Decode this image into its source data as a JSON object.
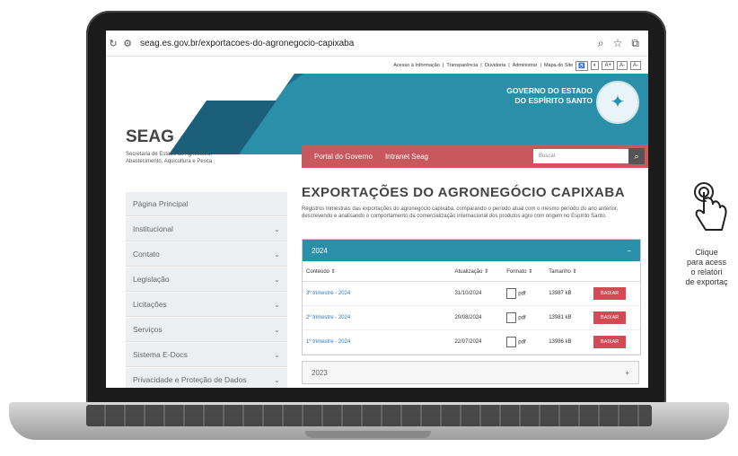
{
  "browser": {
    "url": "seag.es.gov.br/exportacoes-do-agronegocio-capixaba"
  },
  "access_bar": {
    "items": [
      "Acesso à Informação",
      "Transparência",
      "Ouvidoria",
      "Administrar",
      "Mapa do Site"
    ],
    "font_buttons": [
      "A+",
      "A-",
      "A-"
    ]
  },
  "header": {
    "org_short": "SEAG",
    "org_full": "Secretaria de Estado da Agricultura, Abastecimento, Aquicultura e Pesca",
    "gov_line1": "GOVERNO DO ESTADO",
    "gov_line2": "DO ESPÍRITO SANTO"
  },
  "nav": {
    "links": [
      "Portal do Governo",
      "Intranet Seag"
    ],
    "search_placeholder": "Buscar"
  },
  "sidebar": {
    "items": [
      {
        "label": "Página Principal",
        "chevron": false
      },
      {
        "label": "Institucional",
        "chevron": true
      },
      {
        "label": "Contato",
        "chevron": true
      },
      {
        "label": "Legislação",
        "chevron": true
      },
      {
        "label": "Licitações",
        "chevron": true
      },
      {
        "label": "Serviços",
        "chevron": true
      },
      {
        "label": "Sistema E-Docs",
        "chevron": true
      },
      {
        "label": "Privacidade e Proteção de Dados",
        "chevron": true
      }
    ]
  },
  "main": {
    "title": "EXPORTAÇÕES DO AGRONEGÓCIO CAPIXABA",
    "description": "Registros trimestrais das exportações do agronegócio capixaba, comparando o período atual com o mesmo período do ano anterior, descrevendo e analisando o comportamento da comercialização internacional dos produtos agro com origem no Espírito Santo.",
    "panel_year": "2024",
    "panel_toggle": "−",
    "columns": [
      "Conteúdo ⇕",
      "Atualização ⇕",
      "Formato ⇕",
      "Tamanho ⇕"
    ],
    "rows": [
      {
        "content": "3º trimestre - 2024",
        "updated": "31/10/2024",
        "format": "pdf",
        "size": "13987 kB",
        "action": "BAIXAR"
      },
      {
        "content": "2º trimestre - 2024",
        "updated": "20/08/2024",
        "format": "pdf",
        "size": "13981 kB",
        "action": "BAIXAR"
      },
      {
        "content": "1º trimestre - 2024",
        "updated": "22/07/2024",
        "format": "pdf",
        "size": "13986 kB",
        "action": "BAIXAR"
      }
    ],
    "panel2_year": "2023",
    "panel2_toggle": "+"
  },
  "hint": {
    "line1": "Clique",
    "line2": "para acess",
    "line3": "o relatóri",
    "line4": "de exportaç"
  }
}
